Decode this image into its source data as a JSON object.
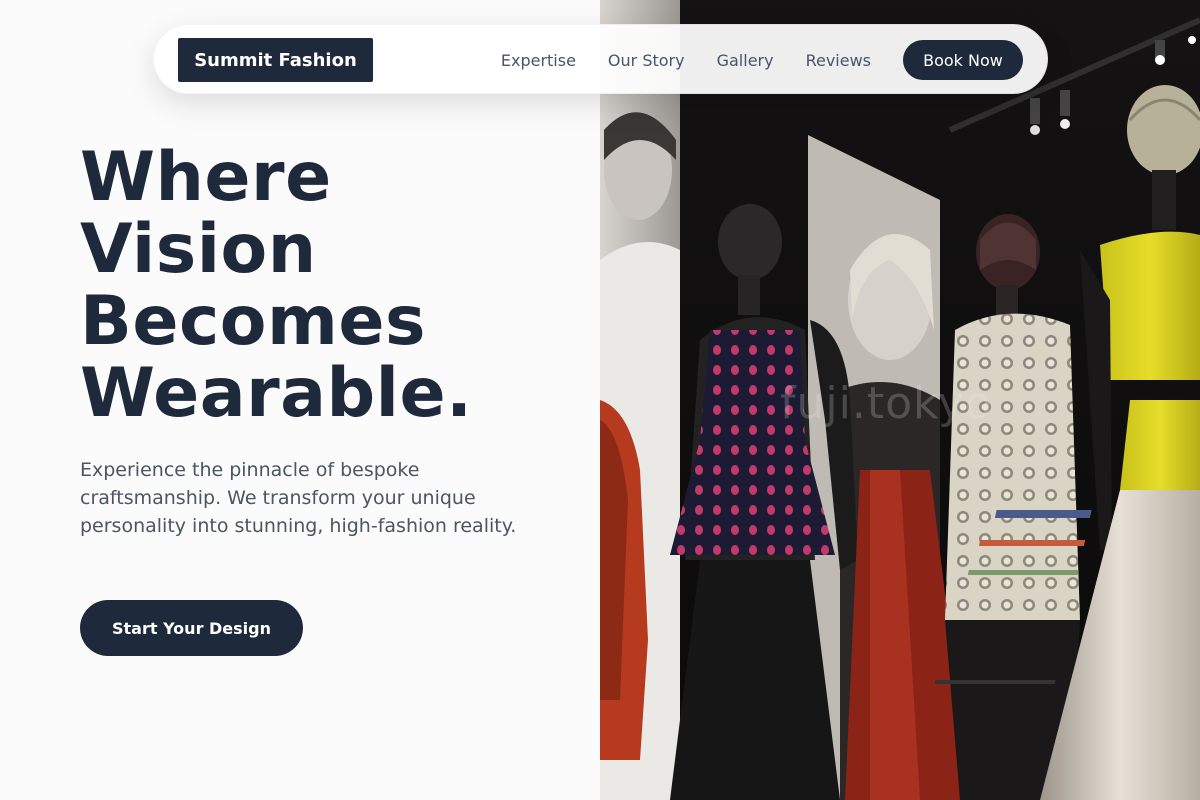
{
  "nav": {
    "brand": "Summit Fashion",
    "links": [
      "Expertise",
      "Our Story",
      "Gallery",
      "Reviews"
    ],
    "book_label": "Book Now"
  },
  "hero": {
    "headline_lines": [
      "Where",
      "Vision",
      "Becomes",
      "Wearable."
    ],
    "subtext": "Experience the pinnacle of bespoke craftsmanship. We transform your unique personality into stunning, high-fashion reality.",
    "cta_label": "Start Your Design"
  },
  "image": {
    "description_icon": "fashion-exhibit-photo",
    "watermark": "fuji.tokyo"
  },
  "colors": {
    "primary": "#1e293b",
    "text_muted": "#4b5563",
    "nav_link": "#475569",
    "background": "#fbfbfb"
  }
}
